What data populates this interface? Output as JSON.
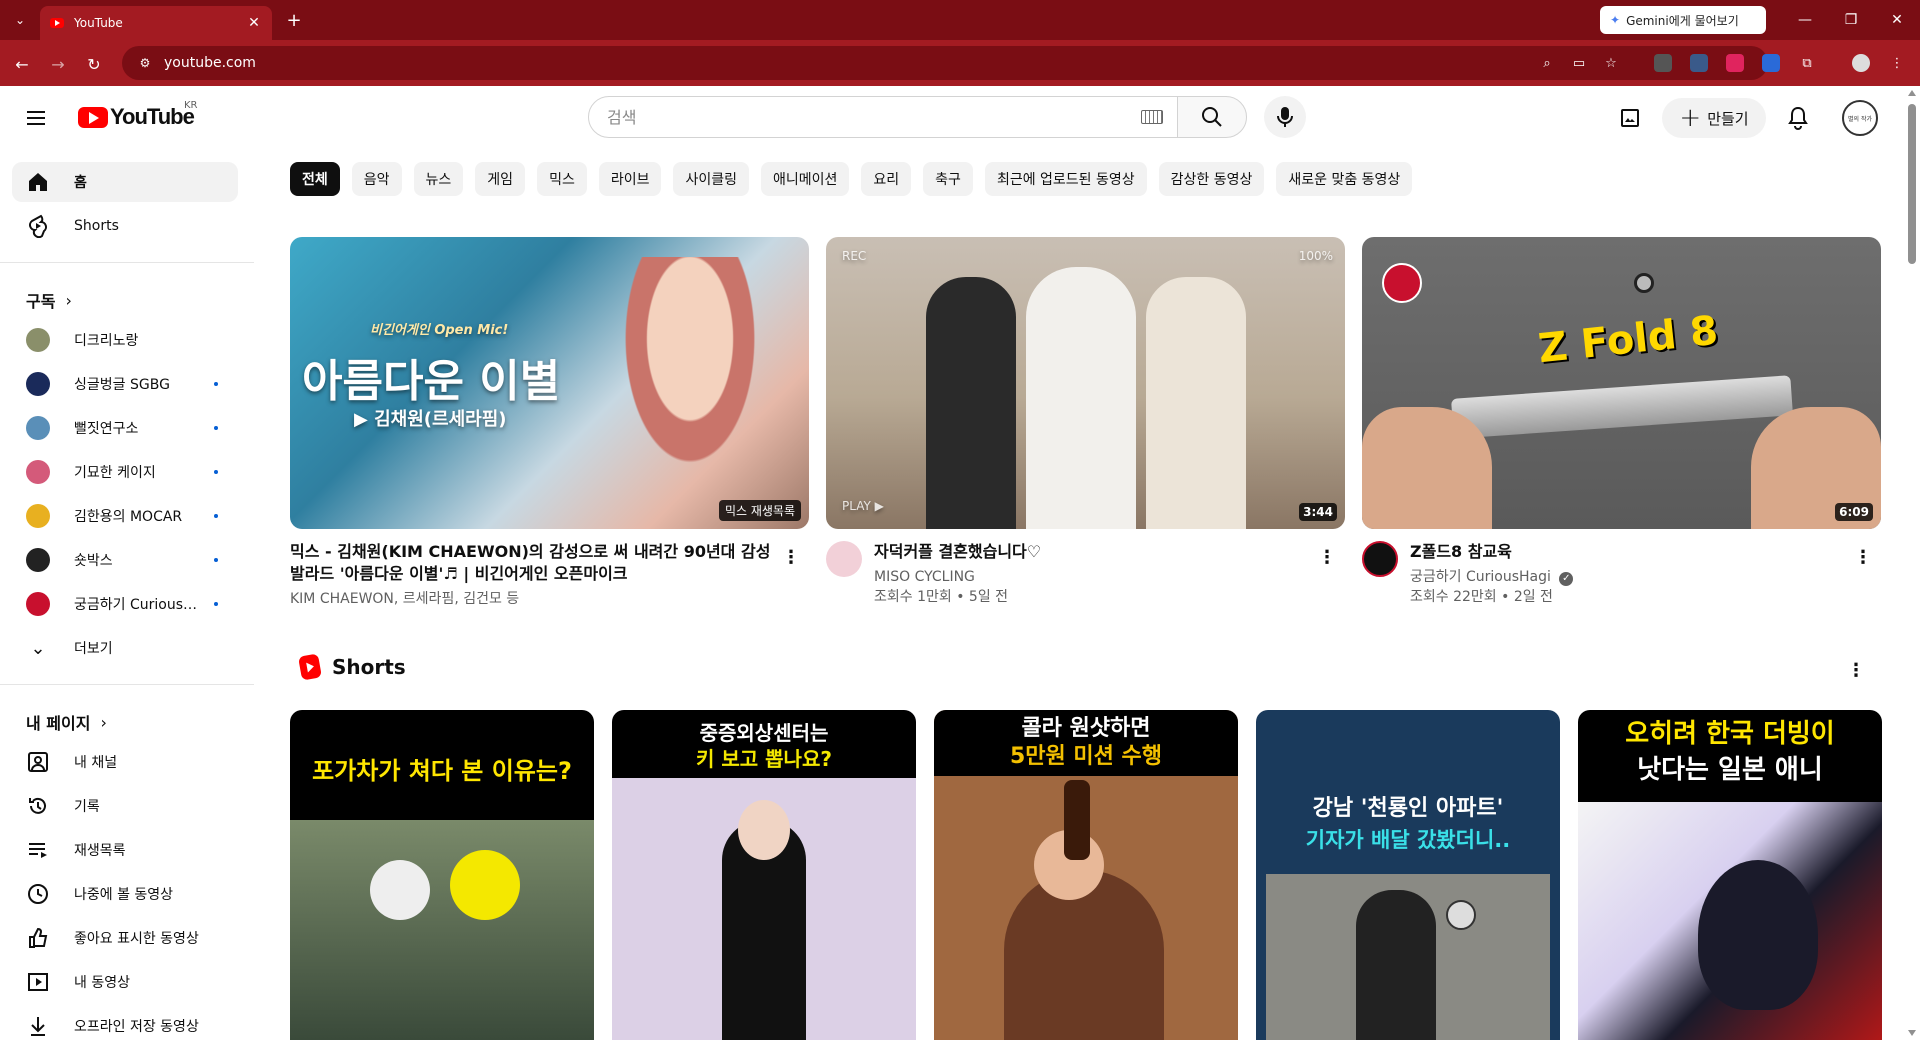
{
  "browser": {
    "tab_title": "YouTube",
    "url": "youtube.com",
    "gemini_label": "Gemini에게 물어보기",
    "accent": "#a31b22"
  },
  "masthead": {
    "logo_text": "YouTube",
    "region": "KR",
    "search_placeholder": "검색",
    "create_label": "만들기",
    "avatar_text": "별의 작가"
  },
  "sidebar": {
    "main": [
      {
        "label": "홈",
        "icon": "home-icon"
      },
      {
        "label": "Shorts",
        "icon": "shorts-icon"
      }
    ],
    "subscriptions_title": "구독",
    "subscriptions": [
      {
        "label": "디크리노랑",
        "color": "#8a8f6a",
        "new": false
      },
      {
        "label": "싱글벙글 SGBG",
        "color": "#1a2a5a",
        "new": true
      },
      {
        "label": "뻘짓연구소",
        "color": "#5a8fb8",
        "new": true
      },
      {
        "label": "기묘한 케이지",
        "color": "#d45a7a",
        "new": true
      },
      {
        "label": "김한용의 MOCAR",
        "color": "#e8b020",
        "new": true
      },
      {
        "label": "숏박스",
        "color": "#222222",
        "new": true
      },
      {
        "label": "궁금하기 CuriousHagi",
        "color": "#c8102e",
        "new": true
      }
    ],
    "more_label": "더보기",
    "you_title": "내 페이지",
    "you_items": [
      {
        "label": "내 채널",
        "icon": "channel-icon"
      },
      {
        "label": "기록",
        "icon": "history-icon"
      },
      {
        "label": "재생목록",
        "icon": "playlists-icon"
      },
      {
        "label": "나중에 볼 동영상",
        "icon": "watch-later-icon"
      },
      {
        "label": "좋아요 표시한 동영상",
        "icon": "liked-icon"
      },
      {
        "label": "내 동영상",
        "icon": "your-videos-icon"
      },
      {
        "label": "오프라인 저장 동영상",
        "icon": "downloads-icon"
      }
    ]
  },
  "chips": [
    "전체",
    "음악",
    "뉴스",
    "게임",
    "믹스",
    "라이브",
    "사이클링",
    "애니메이션",
    "요리",
    "축구",
    "최근에 업로드된 동영상",
    "감상한 동영상",
    "새로운 맞춤 동영상"
  ],
  "videos": [
    {
      "title": "믹스 - 김채원(KIM CHAEWON)의 감성으로 써 내려간 90년대 감성 발라드 '아름다운 이별'♬ | 비긴어게인 오픈마이크",
      "channel": "KIM CHAEWON, 르세라핌, 김건모 등",
      "stats": "",
      "badge": "믹스 재생목록",
      "thumb_title": "아름다운 이별",
      "thumb_sub": "▶ 김채원(르세라핌)",
      "thumb_tag": "비긴어게인 Open Mic!"
    },
    {
      "title": "자덕커플 결혼했습니다♡",
      "channel": "MISO CYCLING",
      "stats": "조회수 1만회 • 5일 전",
      "duration": "3:44",
      "rec_label": "REC",
      "battery": "100%",
      "play_label": "PLAY ▶"
    },
    {
      "title": "Z폴드8 참교육",
      "channel": "궁금하기 CuriousHagi",
      "stats": "조회수 22만회 • 2일 전",
      "duration": "6:09",
      "thumb_title": "Z Fold 8"
    }
  ],
  "shorts": {
    "title": "Shorts",
    "items": [
      {
        "caption": "포가차가 쳐다 본 이유는?"
      },
      {
        "caption": "중증외상센터는",
        "caption2": "키 보고 뽑나요?"
      },
      {
        "caption": "콜라 원샷하면",
        "caption2": "5만원 미션 수행"
      },
      {
        "caption": "강남 '천룡인 아파트'",
        "caption2": "기자가 배달 갔봤더니.."
      },
      {
        "caption": "오히려 한국 더빙이",
        "caption2": "낫다는 일본 애니"
      }
    ]
  }
}
